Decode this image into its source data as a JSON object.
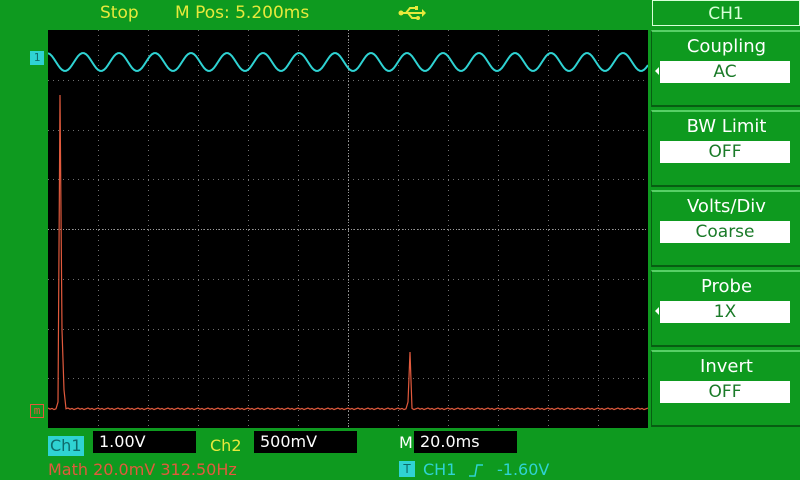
{
  "header": {
    "run_state": "Stop",
    "main_position": "M Pos: 5.200ms"
  },
  "icons": {
    "usb": "usb-icon",
    "trigger_position": "trigger-position-marker"
  },
  "channels": {
    "ch1_marker": "1",
    "ch2_marker": "m"
  },
  "menu": {
    "title": "CH1",
    "items": [
      {
        "label": "Coupling",
        "value": "AC"
      },
      {
        "label": "BW Limit",
        "value": "OFF"
      },
      {
        "label": "Volts/Div",
        "value": "Coarse"
      },
      {
        "label": "Probe",
        "value": "1X"
      },
      {
        "label": "Invert",
        "value": "OFF"
      }
    ]
  },
  "status": {
    "ch1_label": "Ch1",
    "ch1_scale": "1.00V",
    "ch2_label": "Ch2",
    "ch2_scale": "500mV",
    "timebase_label": "M",
    "timebase_value": "20.0ms",
    "math": "Math  20.0mV  312.50Hz",
    "trigger_badge": "T",
    "trigger_source": "CH1",
    "trigger_level": "-1.60V"
  },
  "colors": {
    "background": "#0e9a1f",
    "ch1_trace": "#2fd3d3",
    "math_trace": "#e25a3d",
    "header_text": "#e7e93c",
    "grid": "#6e6e6e"
  }
}
